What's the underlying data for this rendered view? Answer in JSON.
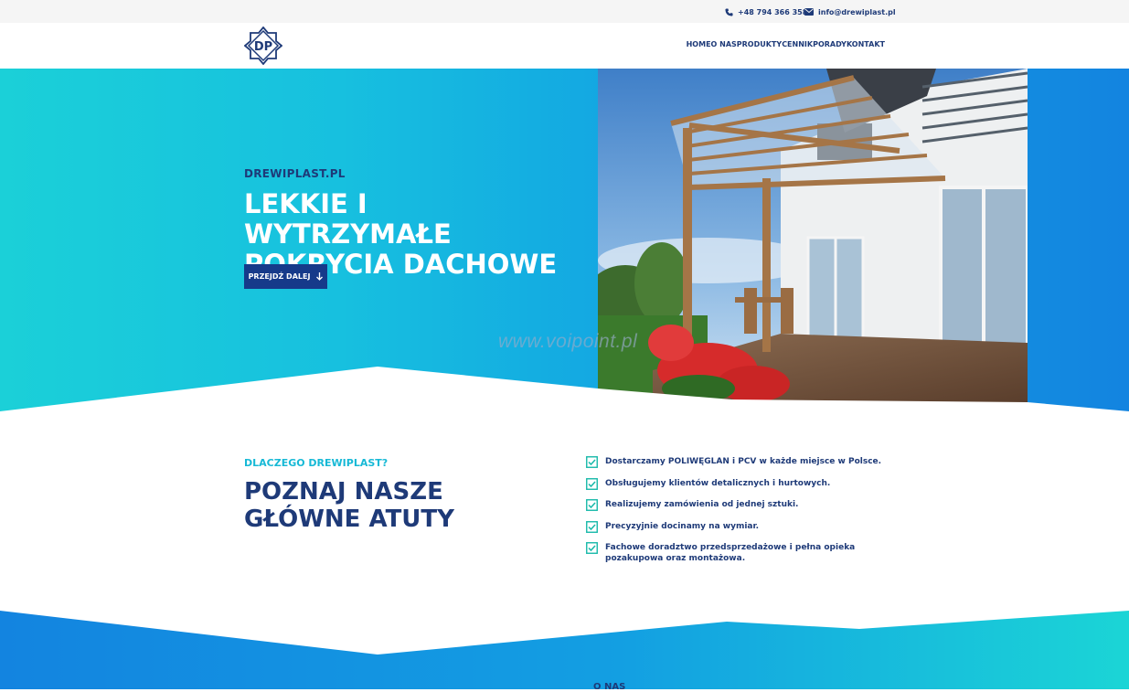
{
  "topbar": {
    "phone": "+48 794 366 358",
    "email": "info@drewiplast.pl",
    "phone_icon": "phone-icon",
    "email_icon": "envelope-icon"
  },
  "header": {
    "logo_text": "DP",
    "nav": [
      "HOME",
      "O NAS",
      "PRODUKTY",
      "CENNIK",
      "PORADY",
      "KONTAKT"
    ]
  },
  "hero": {
    "eyebrow": "DREWIPLAST.PL",
    "title_line1": "LEKKIE I WYTRZYMAŁE",
    "title_line2": "POKRYCIA DACHOWE",
    "button_label": "PRZEJDŹ DALEJ",
    "watermark": "www.voipoint.pl"
  },
  "why": {
    "eyebrow": "DLACZEGO DREWIPLAST?",
    "title_line1": "POZNAJ NASZE",
    "title_line2": "GŁÓWNE ATUTY",
    "features": [
      "Dostarczamy POLIWĘGLAN i PCV w każde miejsce w Polsce.",
      "Obsługujemy klientów detalicznych i hurtowych.",
      "Realizujemy zamówienia od jednej sztuki.",
      "Precyzyjnie docinamy na wymiar.",
      "Fachowe doradztwo przedsprzedażowe i pełna opieka pozakupowa oraz montażowa."
    ]
  },
  "about": {
    "eyebrow": "O NAS"
  },
  "colors": {
    "navy": "#1e3a78",
    "button": "#163a8a",
    "cyan": "#1bd0d8",
    "blue": "#1384e0",
    "accent": "#17b9d6"
  }
}
